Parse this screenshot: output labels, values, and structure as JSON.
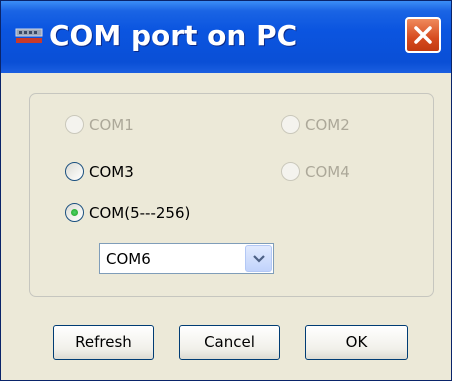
{
  "window": {
    "title": "COM port on PC"
  },
  "port_options": [
    {
      "label": "COM1",
      "selected": false,
      "disabled": true
    },
    {
      "label": "COM2",
      "selected": false,
      "disabled": true
    },
    {
      "label": "COM3",
      "selected": false,
      "disabled": false
    },
    {
      "label": "COM4",
      "selected": false,
      "disabled": true
    },
    {
      "label": "COM(5---256)",
      "selected": true,
      "disabled": false
    }
  ],
  "port_select": {
    "value": "COM6"
  },
  "buttons": {
    "refresh": "Refresh",
    "cancel": "Cancel",
    "ok": "OK"
  },
  "colors": {
    "titlebar": "#0a4fd6",
    "dialog_bg": "#ece9d8",
    "close_button": "#d64b1f",
    "radio_selected_dot": "#21a121",
    "disabled_text": "#aca899"
  }
}
